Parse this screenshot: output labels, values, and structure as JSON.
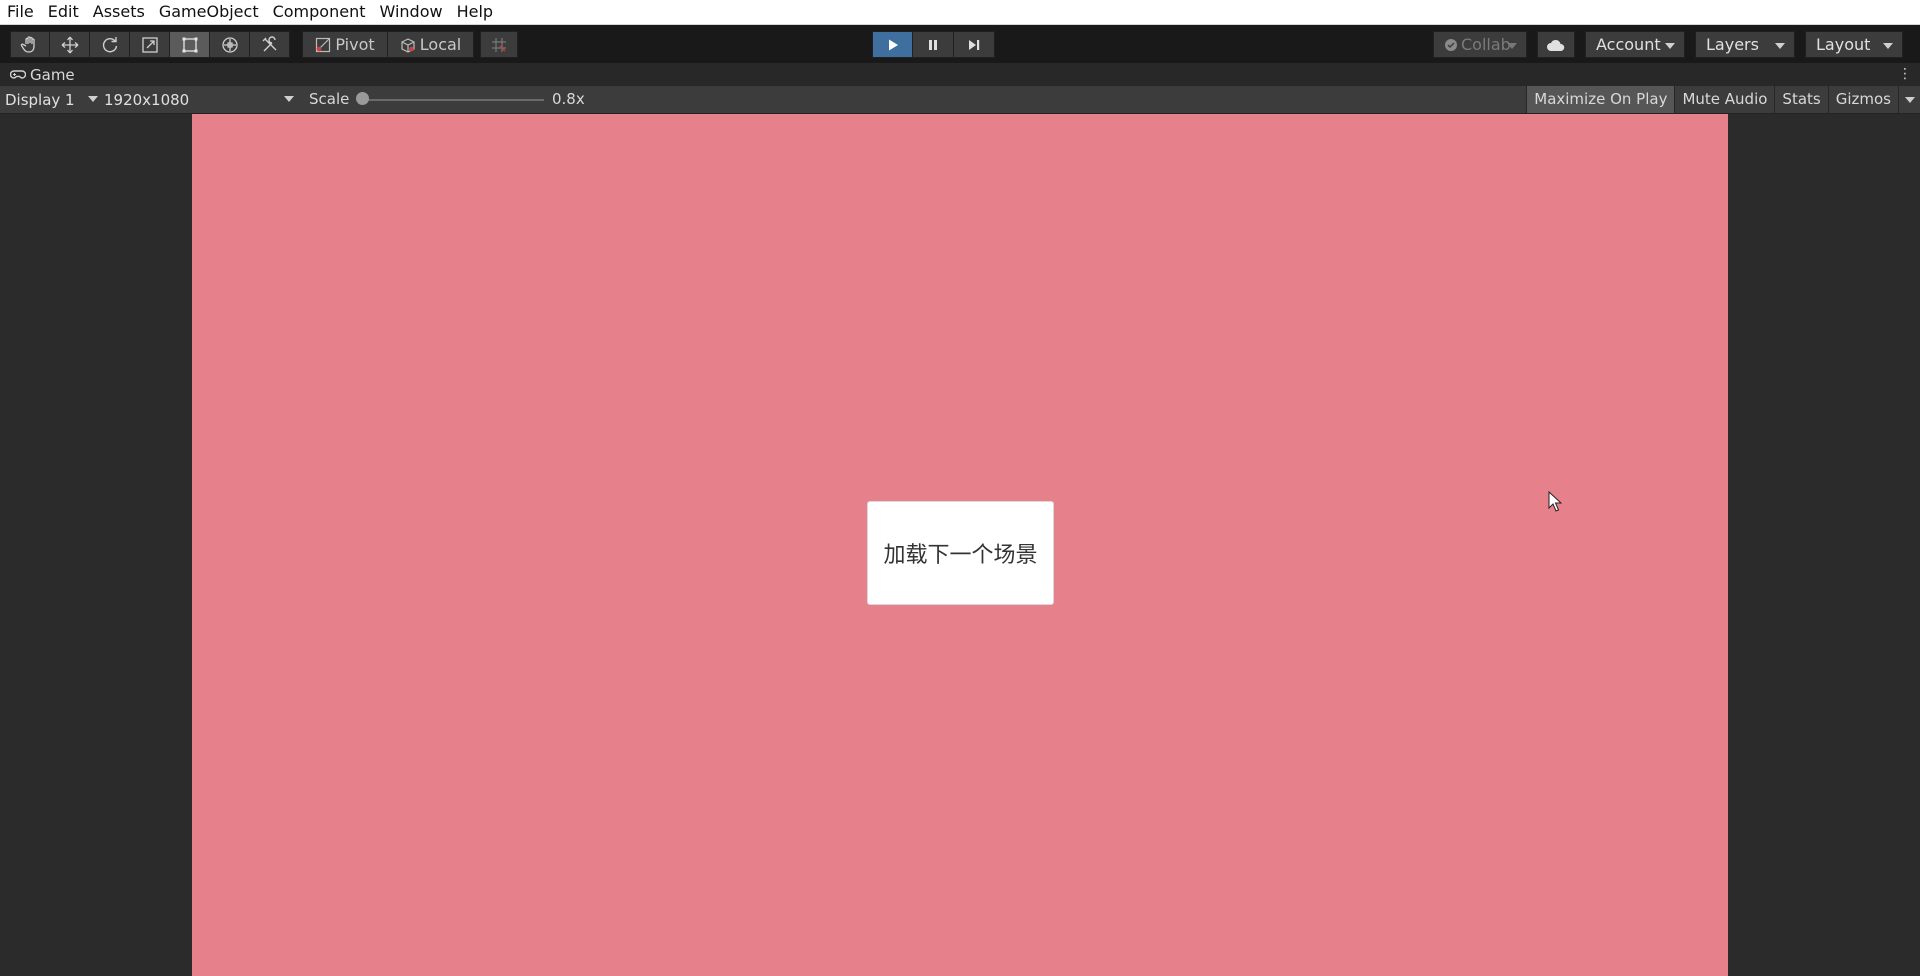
{
  "menu": [
    "File",
    "Edit",
    "Assets",
    "GameObject",
    "Component",
    "Window",
    "Help"
  ],
  "toolbar": {
    "tools": [
      "hand-tool",
      "move-tool",
      "rotate-tool",
      "scale-tool",
      "rect-tool",
      "transform-tool",
      "custom-tool"
    ],
    "selected_tool": "rect-tool",
    "pivot_label": "Pivot",
    "local_label": "Local",
    "collab_label": "Collab",
    "account_label": "Account",
    "layers_label": "Layers",
    "layout_label": "Layout",
    "play_active": true,
    "accent": "#3e6f9e"
  },
  "game_tab": {
    "label": "Game"
  },
  "game_view": {
    "display_label": "Display 1",
    "resolution_label": "1920x1080",
    "scale_label": "Scale",
    "scale_value": "0.8x",
    "scale_level": 0.0,
    "buttons": [
      "Maximize On Play",
      "Mute Audio",
      "Stats",
      "Gizmos"
    ],
    "maximize_on": true
  },
  "game_canvas": {
    "background": "#e6808b",
    "button_label": "加载下一个场景"
  }
}
